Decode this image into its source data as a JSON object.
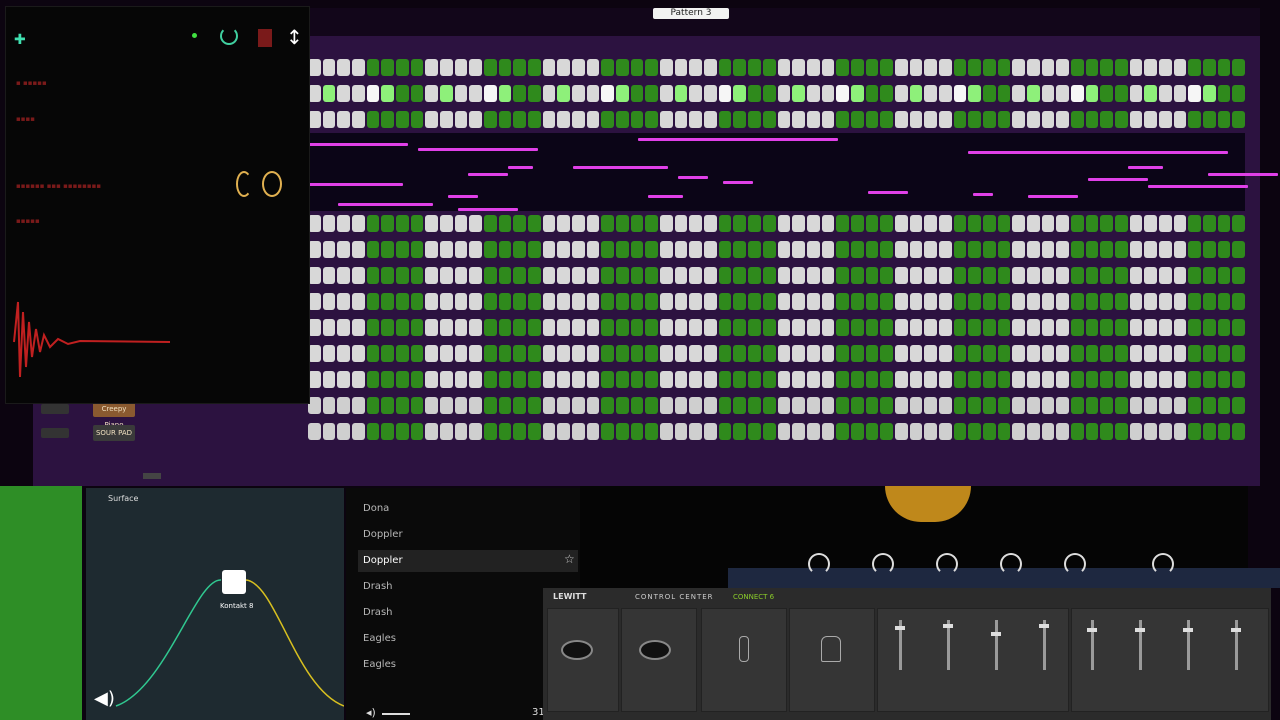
{
  "rack": {
    "pattern_label": "Pattern 3",
    "rows": [
      {
        "name": "Creepy Piano"
      },
      {
        "name": "SOUR PAD"
      }
    ]
  },
  "graph": {
    "title": "Surface",
    "node_label": "Kontakt 8"
  },
  "list": {
    "items": [
      "Dona",
      "Doppler",
      "Doppler",
      "Drash",
      "Drash",
      "Eagles",
      "Eagles"
    ],
    "selected_index": 2,
    "footer_number": "31"
  },
  "lewitt": {
    "brand": "LEWITT",
    "title": "CONTROL CENTER",
    "device": "CONNECT 6"
  },
  "colors": {
    "step_green": "#2f8a1c",
    "step_white": "#d8d8d8",
    "note_magenta": "#e040e8",
    "frame_purple": "#2c1240"
  }
}
